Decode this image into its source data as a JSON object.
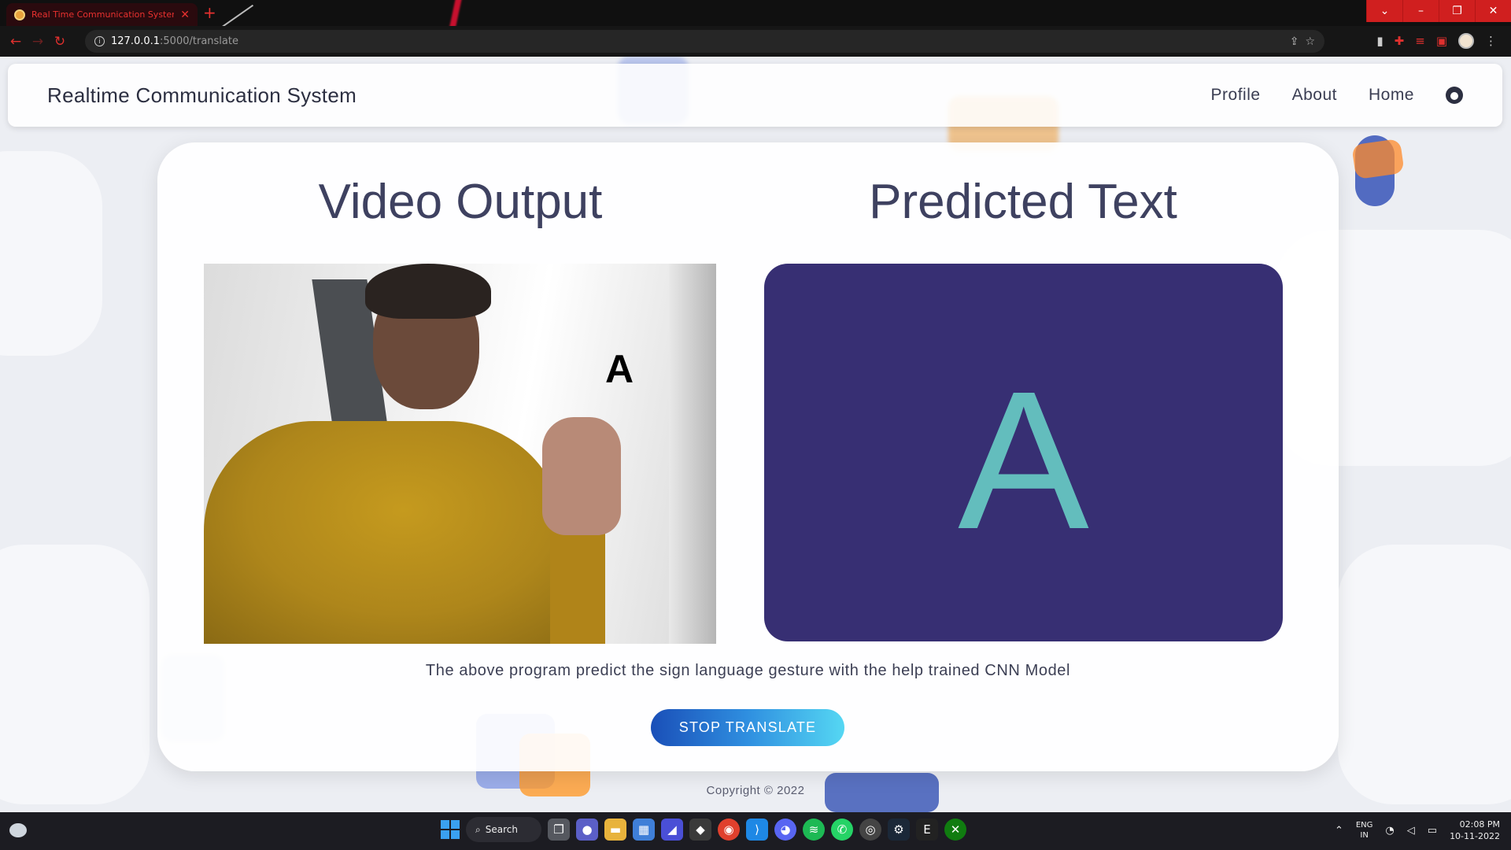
{
  "browser": {
    "tab_title": "Real Time Communication System",
    "url_host": "127.0.0.1",
    "url_rest": ":5000/translate"
  },
  "nav": {
    "brand": "Realtime Communication System",
    "links": [
      "Profile",
      "About",
      "Home"
    ]
  },
  "main": {
    "video_title": "Video Output",
    "video_overlay_label": "A",
    "predicted_title": "Predicted Text",
    "predicted_value": "A",
    "description": "The above program predict the sign language gesture with the help trained CNN Model",
    "button_label": "STOP TRANSLATE"
  },
  "footer": {
    "copyright": "Copyright © 2022"
  },
  "taskbar": {
    "search_label": "Search",
    "lang_top": "ENG",
    "lang_bottom": "IN",
    "time": "02:08 PM",
    "date": "10-11-2022"
  },
  "colors": {
    "predicted_box": "#372f73",
    "predicted_letter": "#63bdbd",
    "button_gradient_start": "#1a4fb8",
    "button_gradient_end": "#55d7f3"
  }
}
